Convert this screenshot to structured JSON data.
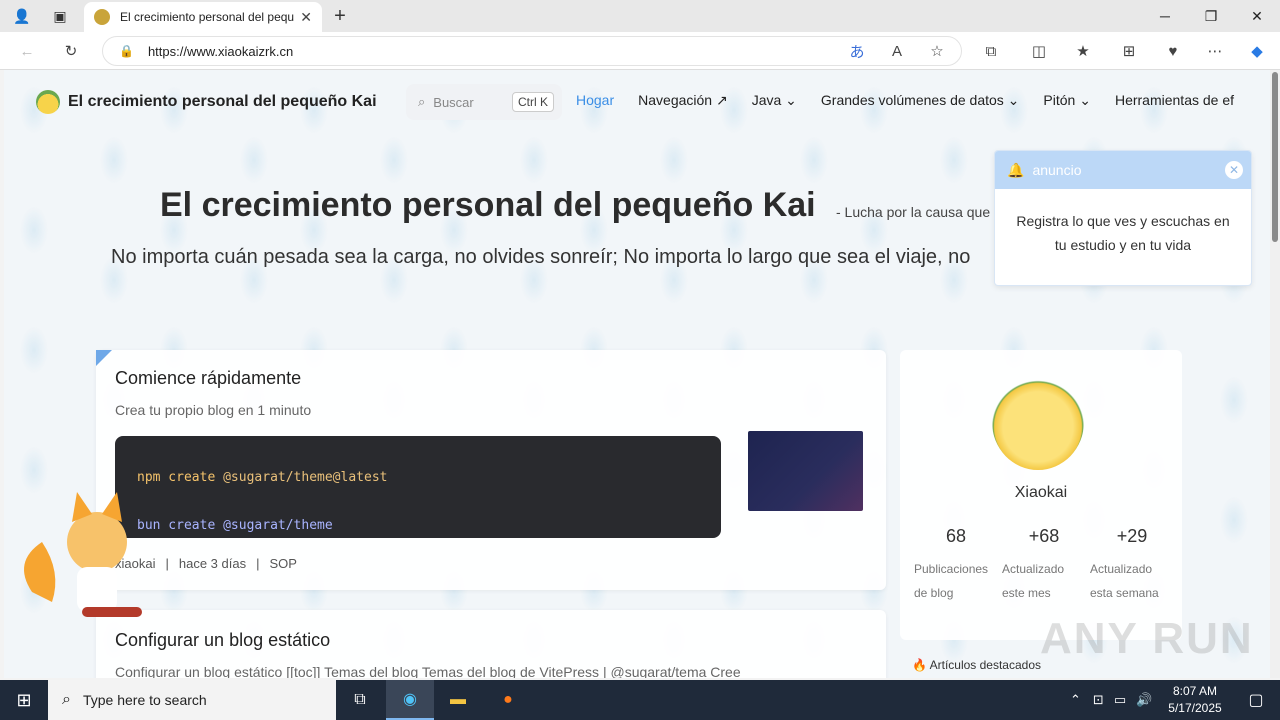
{
  "browser": {
    "tab_title": "El crecimiento personal del pequ",
    "tab_close": "✕",
    "new_tab": "+",
    "url": "https://www.xiaokaizrk.cn",
    "window_minimize": "─",
    "window_restore": "❐",
    "window_close": "✕"
  },
  "site": {
    "brand": "El crecimiento personal del pequeño Kai",
    "search_placeholder": "Buscar",
    "search_shortcut": "Ctrl K",
    "nav": [
      {
        "label": "Hogar",
        "active": true
      },
      {
        "label": "Navegación ↗"
      },
      {
        "label": "Java ⌄"
      },
      {
        "label": "Grandes volúmenes de datos ⌄"
      },
      {
        "label": "Pitón ⌄"
      },
      {
        "label": "Herramientas de ef"
      }
    ]
  },
  "hero": {
    "title": "El crecimiento personal del pequeño Kai",
    "subtitle": "- Lucha por la causa que",
    "tagline": "No importa cuán pesada sea la carga, no olvides sonreír; No importa lo largo que sea el viaje, no"
  },
  "notice": {
    "title": "anuncio",
    "close": "✕",
    "body": "Registra lo que ves y escuchas en tu estudio y en tu vida"
  },
  "posts": [
    {
      "title": "Comience rápidamente",
      "desc": "Crea tu propio blog en 1 minuto",
      "code_line1_cmd": "npm create",
      "code_line1_pkg": "@sugarat/theme@latest",
      "code_line2_cmd": "bun create",
      "code_line2_pkg": "@sugarat/theme",
      "author": "xiaokai",
      "time": "hace 3 días",
      "tag": "SOP"
    },
    {
      "title": "Configurar un blog estático",
      "desc": "Configurar un blog estático [[toc]] Temas del blog Temas del blog de VitePress | @sugarat/tema Cree"
    }
  ],
  "profile": {
    "name": "Xiaokai",
    "stats": [
      {
        "num": "68",
        "label": "Publicaciones de blog"
      },
      {
        "num": "+68",
        "label": "Actualizado este mes"
      },
      {
        "num": "+29",
        "label": "Actualizado esta semana"
      }
    ]
  },
  "featured": "🔥 Artículos destacados",
  "watermark": "ANY RUN",
  "taskbar": {
    "search_placeholder": "Type here to search",
    "time": "8:07 AM",
    "date": "5/17/2025"
  }
}
